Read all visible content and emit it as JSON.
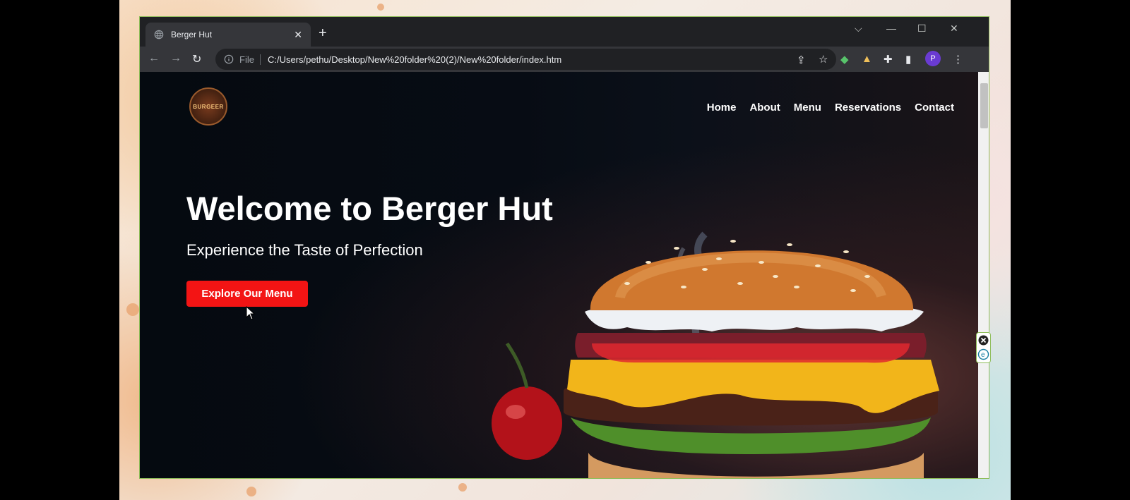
{
  "browser": {
    "tab_title": "Berger Hut",
    "omnibox": {
      "scheme_label": "File",
      "url": "C:/Users/pethu/Desktop/New%20folder%20(2)/New%20folder/index.htm"
    },
    "profile_initial": "P"
  },
  "site": {
    "logo_text": "BURGEER",
    "nav": [
      "Home",
      "About",
      "Menu",
      "Reservations",
      "Contact"
    ],
    "hero": {
      "title": "Welcome to Berger Hut",
      "subtitle": "Experience the Taste of Perfection",
      "cta": "Explore Our Menu"
    }
  },
  "colors": {
    "accent": "#f31414",
    "window_border": "#8fbd5a",
    "page_bg": "#050a10"
  },
  "icons": [
    "globe-icon",
    "close-icon",
    "plus-icon",
    "back-arrow-icon",
    "forward-arrow-icon",
    "reload-icon",
    "info-icon",
    "share-icon",
    "star-icon",
    "extensions-icon",
    "side-panel-icon",
    "kebab-menu-icon"
  ]
}
